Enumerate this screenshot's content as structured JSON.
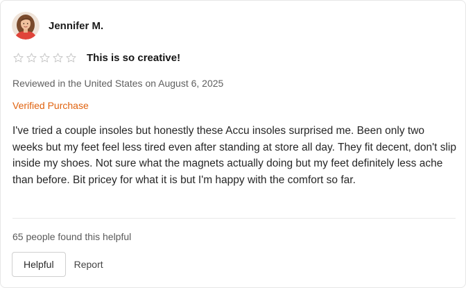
{
  "reviewer": {
    "name": "Jennifer M.",
    "avatar_icon": "user-avatar-photo"
  },
  "rating": {
    "value": 0,
    "max": 5,
    "star_icon": "star-outline-icon",
    "star_color": "#c8c8c8"
  },
  "review": {
    "title": "This is so creative!",
    "meta": "Reviewed in the United States on August 6, 2025",
    "verified_label": "Verified Purchase",
    "verified_color": "#e0620e",
    "body": "I've tried a couple insoles but honestly these Accu insoles surprised me. Been only two weeks but my feet feel less tired even after standing at store all day. They fit decent, don't slip inside my shoes. Not sure what the magnets actually doing but my feet definitely less ache than before. Bit pricey for what it is but I'm happy with the comfort so far."
  },
  "feedback": {
    "helpful_count_text": "65 people found this helpful",
    "helpful_button_label": "Helpful",
    "report_label": "Report"
  }
}
